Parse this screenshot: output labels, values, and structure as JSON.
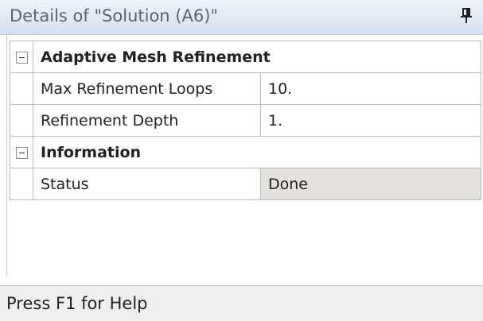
{
  "window": {
    "title": "Details of \"Solution (A6)\"",
    "pin_icon": "pin-icon"
  },
  "groups": [
    {
      "title": "Adaptive Mesh Refinement",
      "expanded": true,
      "rows": [
        {
          "label": "Max Refinement Loops",
          "value": "10."
        },
        {
          "label": "Refinement Depth",
          "value": "1."
        }
      ]
    },
    {
      "title": "Information",
      "expanded": true,
      "rows": [
        {
          "label": "Status",
          "value": "Done"
        }
      ]
    }
  ],
  "statusbar": {
    "text": "Press F1 for Help"
  },
  "colors": {
    "titlebar": "#d6e1ef",
    "readonly_value": "#e4e0dc"
  }
}
